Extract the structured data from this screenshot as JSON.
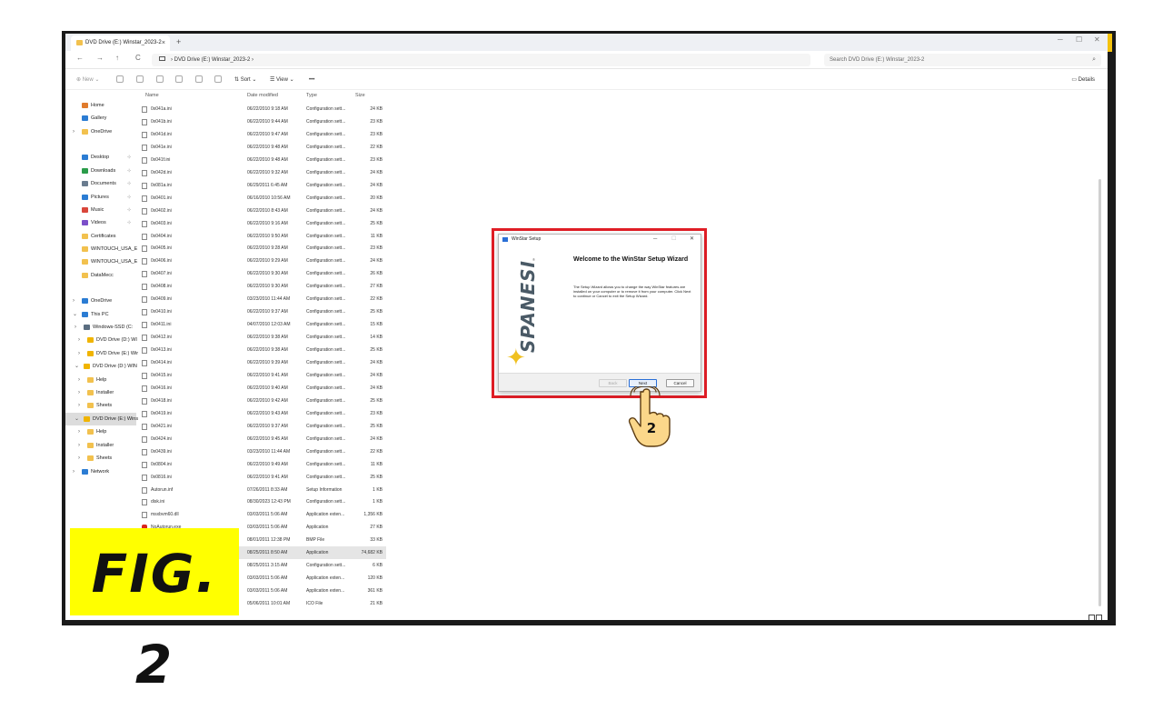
{
  "window": {
    "tab_title": "DVD Drive (E:) Winstar_2023-2",
    "tab_close": "×",
    "new_tab": "+",
    "controls": {
      "minimize": "─",
      "maximize": "☐",
      "close": "✕"
    }
  },
  "address": {
    "back": "←",
    "forward": "→",
    "up": "↑",
    "refresh": "C",
    "path": "›  DVD Drive (E:) Winstar_2023-2  ›",
    "search_placeholder": "Search DVD Drive (E:) Winstar_2023-2",
    "search_icon": "⌕"
  },
  "toolbar": {
    "new_label": "New",
    "sort_label": "Sort",
    "view_label": "View",
    "more_label": "•••",
    "details_label": "Details"
  },
  "sidebar": {
    "items": [
      {
        "label": "Home",
        "icon": "home-icon",
        "color": "#e07b2d"
      },
      {
        "label": "Gallery",
        "icon": "gallery-icon",
        "color": "#2b7cd3"
      },
      {
        "label": "OneDrive",
        "icon": "folder-icon",
        "color": "#f2c14e",
        "arrow": "›"
      },
      {
        "label": "Desktop",
        "icon": "desktop-icon",
        "color": "#2b7cd3",
        "pin": "⊹"
      },
      {
        "label": "Downloads",
        "icon": "download-icon",
        "color": "#2b9c4a",
        "pin": "⊹"
      },
      {
        "label": "Documents",
        "icon": "document-icon",
        "color": "#6a7c8f",
        "pin": "⊹"
      },
      {
        "label": "Pictures",
        "icon": "pictures-icon",
        "color": "#2b7cd3",
        "pin": "⊹"
      },
      {
        "label": "Music",
        "icon": "music-icon",
        "color": "#d9463b",
        "pin": "⊹"
      },
      {
        "label": "Videos",
        "icon": "videos-icon",
        "color": "#7b4fc9",
        "pin": "⊹"
      },
      {
        "label": "Certificates",
        "icon": "folder-icon",
        "color": "#f2c14e"
      },
      {
        "label": "WINTOUCH_USA_E",
        "icon": "folder-icon",
        "color": "#f2c14e"
      },
      {
        "label": "WINTOUCH_USA_E",
        "icon": "folder-icon",
        "color": "#f2c14e"
      },
      {
        "label": "DataMecc",
        "icon": "folder-icon",
        "color": "#f2c14e"
      },
      {
        "label": "OneDrive",
        "icon": "cloud-icon",
        "color": "#2b7cd3",
        "arrow": "›"
      },
      {
        "label": "This PC",
        "icon": "pc-icon",
        "color": "#2b7cd3",
        "arrow": "⌄"
      },
      {
        "label": "Windows-SSD (C:",
        "icon": "drive-icon",
        "color": "#5a6d80",
        "arrow": "›"
      },
      {
        "label": "DVD Drive (D:) WI",
        "icon": "dvd-icon",
        "color": "#f0b400",
        "arrow": "›"
      },
      {
        "label": "DVD Drive (E:) Wir",
        "icon": "dvd-icon",
        "color": "#f0b400",
        "arrow": "›"
      },
      {
        "label": "DVD Drive (D:) WIN",
        "icon": "dvd-icon",
        "color": "#f0b400",
        "arrow": "⌄"
      },
      {
        "label": "Help",
        "icon": "folder-icon",
        "color": "#f2c14e",
        "arrow": "›"
      },
      {
        "label": "Installer",
        "icon": "folder-icon",
        "color": "#f2c14e",
        "arrow": "›"
      },
      {
        "label": "Sheets",
        "icon": "folder-icon",
        "color": "#f2c14e",
        "arrow": "›"
      },
      {
        "label": "DVD Drive (E:) Wins",
        "icon": "dvd-icon",
        "color": "#f0b400",
        "arrow": "⌄"
      },
      {
        "label": "Help",
        "icon": "folder-icon",
        "color": "#f2c14e",
        "arrow": "›"
      },
      {
        "label": "Installer",
        "icon": "folder-icon",
        "color": "#f2c14e",
        "arrow": "›"
      },
      {
        "label": "Sheets",
        "icon": "folder-icon",
        "color": "#f2c14e",
        "arrow": "›"
      },
      {
        "label": "Network",
        "icon": "network-icon",
        "color": "#2b7cd3",
        "arrow": "›"
      }
    ]
  },
  "files": {
    "columns": {
      "name": "Name",
      "date": "Date modified",
      "type": "Type",
      "size": "Size"
    },
    "rows": [
      {
        "name": "0x041a.ini",
        "date": "06/22/2010 9:18 AM",
        "type": "Configuration sett...",
        "size": "24 KB"
      },
      {
        "name": "0x041b.ini",
        "date": "06/22/2010 9:44 AM",
        "type": "Configuration sett...",
        "size": "23 KB"
      },
      {
        "name": "0x041d.ini",
        "date": "06/22/2010 9:47 AM",
        "type": "Configuration sett...",
        "size": "23 KB"
      },
      {
        "name": "0x041e.ini",
        "date": "06/22/2010 9:48 AM",
        "type": "Configuration sett...",
        "size": "22 KB"
      },
      {
        "name": "0x041f.ini",
        "date": "06/22/2010 9:48 AM",
        "type": "Configuration sett...",
        "size": "23 KB"
      },
      {
        "name": "0x042d.ini",
        "date": "06/22/2010 9:32 AM",
        "type": "Configuration sett...",
        "size": "24 KB"
      },
      {
        "name": "0x081a.ini",
        "date": "06/29/2011 6:45 AM",
        "type": "Configuration sett...",
        "size": "24 KB"
      },
      {
        "name": "0x0401.ini",
        "date": "06/16/2010 10:56 AM",
        "type": "Configuration sett...",
        "size": "20 KB"
      },
      {
        "name": "0x0402.ini",
        "date": "06/22/2010 8:43 AM",
        "type": "Configuration sett...",
        "size": "24 KB"
      },
      {
        "name": "0x0403.ini",
        "date": "06/22/2010 9:16 AM",
        "type": "Configuration sett...",
        "size": "25 KB"
      },
      {
        "name": "0x0404.ini",
        "date": "06/22/2010 9:50 AM",
        "type": "Configuration sett...",
        "size": "11 KB"
      },
      {
        "name": "0x0405.ini",
        "date": "06/22/2010 9:28 AM",
        "type": "Configuration sett...",
        "size": "23 KB"
      },
      {
        "name": "0x0406.ini",
        "date": "06/22/2010 9:29 AM",
        "type": "Configuration sett...",
        "size": "24 KB"
      },
      {
        "name": "0x0407.ini",
        "date": "06/22/2010 9:30 AM",
        "type": "Configuration sett...",
        "size": "26 KB"
      },
      {
        "name": "0x0408.ini",
        "date": "06/22/2010 9:30 AM",
        "type": "Configuration sett...",
        "size": "27 KB"
      },
      {
        "name": "0x0409.ini",
        "date": "03/23/2010 11:44 AM",
        "type": "Configuration sett...",
        "size": "22 KB"
      },
      {
        "name": "0x0410.ini",
        "date": "06/22/2010 9:37 AM",
        "type": "Configuration sett...",
        "size": "25 KB"
      },
      {
        "name": "0x0411.ini",
        "date": "04/07/2010 12:03 AM",
        "type": "Configuration sett...",
        "size": "15 KB"
      },
      {
        "name": "0x0412.ini",
        "date": "06/22/2010 9:38 AM",
        "type": "Configuration sett...",
        "size": "14 KB"
      },
      {
        "name": "0x0413.ini",
        "date": "06/22/2010 9:38 AM",
        "type": "Configuration sett...",
        "size": "25 KB"
      },
      {
        "name": "0x0414.ini",
        "date": "06/22/2010 9:39 AM",
        "type": "Configuration sett...",
        "size": "24 KB"
      },
      {
        "name": "0x0415.ini",
        "date": "06/22/2010 9:41 AM",
        "type": "Configuration sett...",
        "size": "24 KB"
      },
      {
        "name": "0x0416.ini",
        "date": "06/22/2010 9:40 AM",
        "type": "Configuration sett...",
        "size": "24 KB"
      },
      {
        "name": "0x0418.ini",
        "date": "06/22/2010 9:42 AM",
        "type": "Configuration sett...",
        "size": "25 KB"
      },
      {
        "name": "0x0419.ini",
        "date": "06/22/2010 9:43 AM",
        "type": "Configuration sett...",
        "size": "23 KB"
      },
      {
        "name": "0x0421.ini",
        "date": "06/22/2010 9:37 AM",
        "type": "Configuration sett...",
        "size": "25 KB"
      },
      {
        "name": "0x0424.ini",
        "date": "06/22/2010 9:45 AM",
        "type": "Configuration sett...",
        "size": "24 KB"
      },
      {
        "name": "0x0439.ini",
        "date": "03/23/2010 11:44 AM",
        "type": "Configuration sett...",
        "size": "22 KB"
      },
      {
        "name": "0x0804.ini",
        "date": "06/22/2010 9:49 AM",
        "type": "Configuration sett...",
        "size": "11 KB"
      },
      {
        "name": "0x0816.ini",
        "date": "06/22/2010 9:41 AM",
        "type": "Configuration sett...",
        "size": "25 KB"
      },
      {
        "name": "Autorun.inf",
        "date": "07/26/2011 8:33 AM",
        "type": "Setup Information",
        "size": "1 KB"
      },
      {
        "name": "disk.ini",
        "date": "08/30/2023 12:43 PM",
        "type": "Configuration sett...",
        "size": "1 KB"
      },
      {
        "name": "msxbvm60.dll",
        "date": "03/03/2011 5:06 AM",
        "type": "Application exten...",
        "size": "1,356 KB"
      },
      {
        "name": "NoAutorun.exe",
        "date": "03/03/2011 5:06 AM",
        "type": "Application",
        "size": "27 KB"
      },
      {
        "name": "",
        "date": "08/01/2011 12:38 PM",
        "type": "BMP File",
        "size": "33 KB"
      },
      {
        "name": "",
        "date": "08/25/2011 8:50 AM",
        "type": "Application",
        "size": "74,682 KB"
      },
      {
        "name": "",
        "date": "08/25/2011 3:15 AM",
        "type": "Configuration sett...",
        "size": "6 KB"
      },
      {
        "name": "",
        "date": "03/03/2011 5:06 AM",
        "type": "Application exten...",
        "size": "120 KB"
      },
      {
        "name": "",
        "date": "03/03/2011 5:06 AM",
        "type": "Application exten...",
        "size": "361 KB"
      },
      {
        "name": "",
        "date": "05/06/2011 10:01 AM",
        "type": "ICO File",
        "size": "21 KB"
      }
    ]
  },
  "dialog": {
    "title": "WinStar Setup",
    "heading": "Welcome to the WinStar Setup Wizard",
    "body": "The Setup Wizard allows you to change the way WinStar features are installed on your computer or to remove it from your computer. Click Next to continue or Cancel to exit the Setup Wizard.",
    "brand": "SPANESI",
    "brand_mark": "®",
    "back_label": "Back",
    "next_label": "Next",
    "cancel_label": "Cancel",
    "controls": {
      "minimize": "─",
      "maximize": "☐",
      "close": "✕"
    }
  },
  "annotation": {
    "figure_label": "FIG. 2",
    "step_number": "2",
    "highlight_color": "#e01e26",
    "label_bg": "#ffff00"
  }
}
